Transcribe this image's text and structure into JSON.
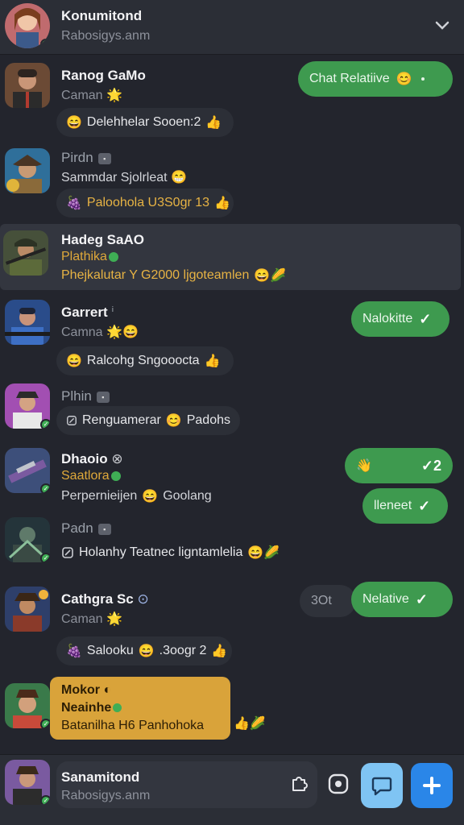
{
  "header": {
    "title": "Konumitond",
    "subtitle": "Rabosigys.anm"
  },
  "chats": [
    {
      "name": "Ranog GaMo",
      "subtitle": "Caman",
      "subtitle_emoji": "🌟",
      "preview": "Delehhelar Sooen:2",
      "preview_lead": "😄",
      "preview_tail": "👍",
      "bubble": "Chat Relatiive",
      "bubble_emoji": "😊"
    },
    {
      "name": "Pirdn",
      "subtitle": "Sammdar Sjolrleat",
      "subtitle_emoji": "😁",
      "preview": "Paloohola U3S0gr 13",
      "preview_lead": "🍇",
      "preview_tail": "👍"
    },
    {
      "name": "Hadeg SaAO",
      "subtitle": "Plathika",
      "preview": "Phejkalutar Y G2000 ljgoteamlen",
      "preview_emoji": "😄🌽"
    },
    {
      "name": "Garrert",
      "subtitle": "Camna",
      "subtitle_emoji": "🌟😄",
      "preview": "Ralcohg Sngooocta",
      "preview_lead": "😄",
      "preview_tail": "👍",
      "bubble": "Nalokitte"
    },
    {
      "name": "Plhin",
      "preview": "Renguamerar",
      "preview_mid": "😊",
      "preview_end": "Padohs"
    },
    {
      "name": "Dhaoio",
      "subtitle": "Saatlora",
      "preview": "Perpernieijen",
      "preview_mid": "😄",
      "preview_end": "Goolang",
      "bubble_top_emoji": "👋",
      "bubble_top_tick": "✓2",
      "bubble": "lleneet"
    },
    {
      "name": "Padn",
      "preview": "Holanhy Teatnec ligntamlelia",
      "preview_emoji": "😄🌽"
    },
    {
      "name": "Cathgra Sc",
      "subtitle": "Caman",
      "subtitle_emoji": "🌟",
      "preview": "Salooku",
      "preview_mid": "😄",
      "preview_end": ".3oogr 2",
      "preview_lead": "🍇",
      "preview_tail": "👍",
      "pill": "3Ot",
      "bubble": "Nelative"
    },
    {
      "name": "Mokor",
      "subtitle": "Neainhe",
      "preview": "Batanilha H6 Panhohoka",
      "preview_emoji": "👍🌽"
    }
  ],
  "composer": {
    "name": "Sanamitond",
    "subtitle": "Rabosigys.anm",
    "sticker_icon": "puzzle-icon",
    "camera_icon": "record-icon",
    "chat_icon": "chat-bubble-icon",
    "add_icon": "plus-icon",
    "chat_button_color": "#7fc4f3",
    "add_button_color": "#2a86e8"
  },
  "colors": {
    "bubble_green": "#3e9a4f",
    "highlight_gold": "#d9a33a",
    "background": "#23252d"
  }
}
